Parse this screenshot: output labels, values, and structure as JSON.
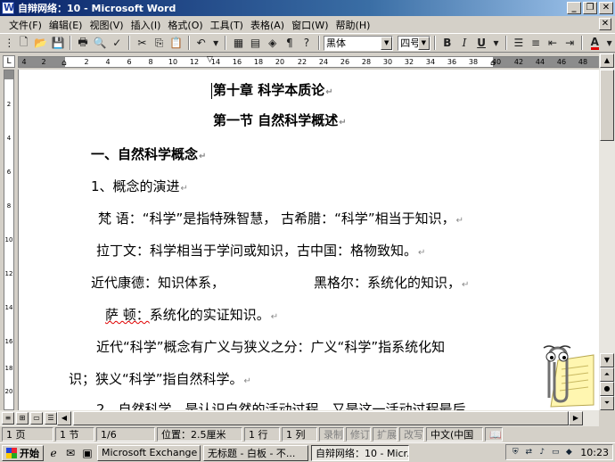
{
  "window": {
    "title": "自辩网络：10 - Microsoft Word",
    "buttons": [
      "_",
      "❐",
      "✕"
    ]
  },
  "menubar": {
    "items": [
      "文件(F)",
      "编辑(E)",
      "视图(V)",
      "插入(I)",
      "格式(O)",
      "工具(T)",
      "表格(A)",
      "窗口(W)",
      "帮助(H)"
    ],
    "close": "✕"
  },
  "toolbar": {
    "font_name": "黑体",
    "font_size": "四号",
    "bold": "B",
    "italic": "I",
    "underline": "U",
    "font_color_label": "A",
    "font_color": "#e00000"
  },
  "ruler": {
    "ticks": [
      "4",
      "2",
      "2",
      "4",
      "6",
      "8",
      "10",
      "12",
      "14",
      "16",
      "18",
      "20",
      "22",
      "24",
      "26",
      "28",
      "30",
      "32",
      "34",
      "36",
      "38",
      "40",
      "42",
      "44",
      "46",
      "48"
    ]
  },
  "vruler": {
    "ticks": [
      "2",
      "4",
      "6",
      "8",
      "10",
      "12",
      "14",
      "16",
      "18",
      "20"
    ]
  },
  "document": {
    "lines": [
      "第十章   科学本质论",
      "第一节   自然科学概述",
      "一、自然科学概念",
      "1、概念的演进",
      "梵    语：“科学”是指特殊智慧，  古希腊：“科学”相当于知识，",
      "拉丁文：科学相当于学问或知识，古中国：格物致知。",
      "近代康德：知识体系，",
      "黑格尔：系统化的知识，",
      "萨    顿：",
      "系统化的实证知识。",
      "近代“科学”概念有广义与狭义之分：广义“科学”指系统化知",
      "识；狭义“科学”指自然科学。",
      "2、自然科学，是认识自然的活动过程，又是这一活动过程最后"
    ],
    "para_mark": "↵"
  },
  "status": {
    "page": "1 页",
    "section": "1 节",
    "pages": "1/6",
    "position": "位置：2.5厘米",
    "line": "1 行",
    "column": "1 列",
    "modes": [
      "录制",
      "修订",
      "扩展",
      "改写"
    ],
    "language": "中文(中国"
  },
  "taskbar": {
    "start": "开始",
    "tasks": [
      "Microsoft Exchange ...",
      "无标题 - 白板 - 不...",
      "自辩网络：10 - Micr..."
    ],
    "clock": "10:23"
  },
  "colors": {
    "titlebar_start": "#0a246a",
    "titlebar_end": "#a6caf0",
    "chrome": "#d4d0c8"
  }
}
